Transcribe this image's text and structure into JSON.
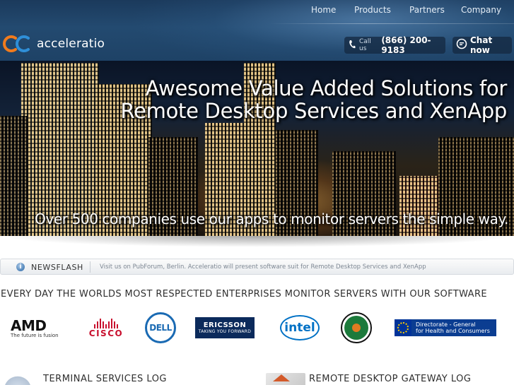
{
  "nav": {
    "items": [
      {
        "label": "Home"
      },
      {
        "label": "Products"
      },
      {
        "label": "Partners"
      },
      {
        "label": "Company"
      }
    ]
  },
  "brand": {
    "name": "acceleratio",
    "logo_colors": [
      "#f07b1d",
      "#2f8fd8"
    ]
  },
  "contact": {
    "call_label": "Call us",
    "phone": "(866) 200-9183",
    "chat_label": "Chat now",
    "phone_icon": "phone-icon",
    "chat_icon": "chat-bubble-icon"
  },
  "hero": {
    "headline_line1": "Awesome Value Added Solutions for",
    "headline_line2": "Remote Desktop Services and XenApp",
    "tagline": "Over 500 companies use our apps to monitor servers the simple way."
  },
  "newsflash": {
    "title": "NEWSFLASH",
    "text": "Visit us on PubForum, Berlin. Acceleratio will present software suit for Remote Desktop Services and XenApp",
    "icon": "info-icon"
  },
  "clients": {
    "heading": "EVERY DAY THE WORLDS MOST RESPECTED ENTERPRISES MONITOR SERVERS WITH OUR SOFTWARE",
    "amd_mark": "AMD",
    "amd_tagline": "The future is fusion",
    "cisco_word": "CISCO",
    "dell_word": "DELL",
    "ericsson_word": "ERICSSON",
    "ericsson_tagline": "TAKING YOU FORWARD",
    "intel_word": "intel",
    "eu_line1": "Directorate - General",
    "eu_line2": "for Health and Consumers"
  },
  "sections": {
    "left_title": "TERMINAL SERVICES LOG",
    "right_title": "REMOTE DESKTOP GATEWAY LOG"
  }
}
